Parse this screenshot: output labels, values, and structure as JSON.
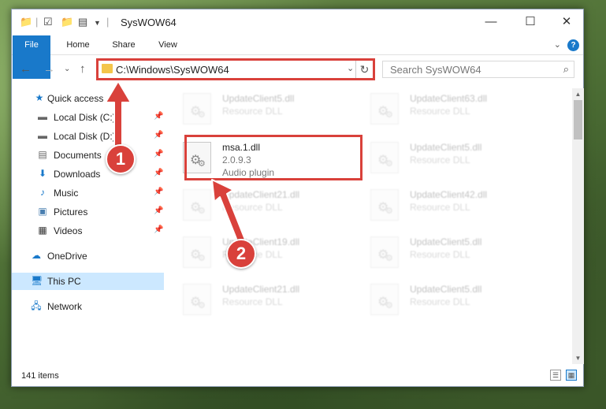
{
  "window": {
    "title": "SysWOW64",
    "minimize": "—",
    "maximize": "☐",
    "close": "✕"
  },
  "ribbon": {
    "tabs": [
      "File",
      "Home",
      "Share",
      "View"
    ],
    "help": "?"
  },
  "address": {
    "path": "C:\\Windows\\SysWOW64",
    "search_placeholder": "Search SysWOW64"
  },
  "sidebar": {
    "items": [
      {
        "label": "Quick access",
        "icon": "star-icon",
        "pinned": false
      },
      {
        "label": "Local Disk (C:)",
        "icon": "drive-icon",
        "pinned": true
      },
      {
        "label": "Local Disk (D:)",
        "icon": "drive-icon",
        "pinned": true
      },
      {
        "label": "Documents",
        "icon": "documents-icon",
        "pinned": true
      },
      {
        "label": "Downloads",
        "icon": "download-icon",
        "pinned": true
      },
      {
        "label": "Music",
        "icon": "music-icon",
        "pinned": true
      },
      {
        "label": "Pictures",
        "icon": "pictures-icon",
        "pinned": true
      },
      {
        "label": "Videos",
        "icon": "videos-icon",
        "pinned": true
      },
      {
        "label": "OneDrive",
        "icon": "cloud-icon",
        "pinned": false
      },
      {
        "label": "This PC",
        "icon": "computer-icon",
        "pinned": false
      },
      {
        "label": "Network",
        "icon": "network-icon",
        "pinned": false
      }
    ],
    "selected": "This PC"
  },
  "files": {
    "highlighted": {
      "name": "msa.1.dll",
      "version": "2.0.9.3",
      "description": "Audio plugin"
    },
    "background": [
      {
        "name": "UpdateClient5.dll",
        "type": "Resource DLL"
      },
      {
        "name": "UpdateClient63.dll",
        "type": "Resource DLL"
      },
      {
        "name": "UpdateClient5.dll",
        "type": "Resource DLL"
      },
      {
        "name": "UpdateClient21.dll",
        "type": "Resource DLL"
      },
      {
        "name": "UpdateClient42.dll",
        "type": "Resource DLL"
      },
      {
        "name": "UpdateClient19.dll",
        "type": "Resource DLL"
      },
      {
        "name": "UpdateClient5.dll",
        "type": "Resource DLL"
      },
      {
        "name": "UpdateClient21.dll",
        "type": "Resource DLL"
      },
      {
        "name": "UpdateClient5.dll",
        "type": "Resource DLL"
      }
    ]
  },
  "status": {
    "item_count": "141 items"
  },
  "callouts": {
    "step1": "1",
    "step2": "2",
    "color": "#d9413b"
  }
}
